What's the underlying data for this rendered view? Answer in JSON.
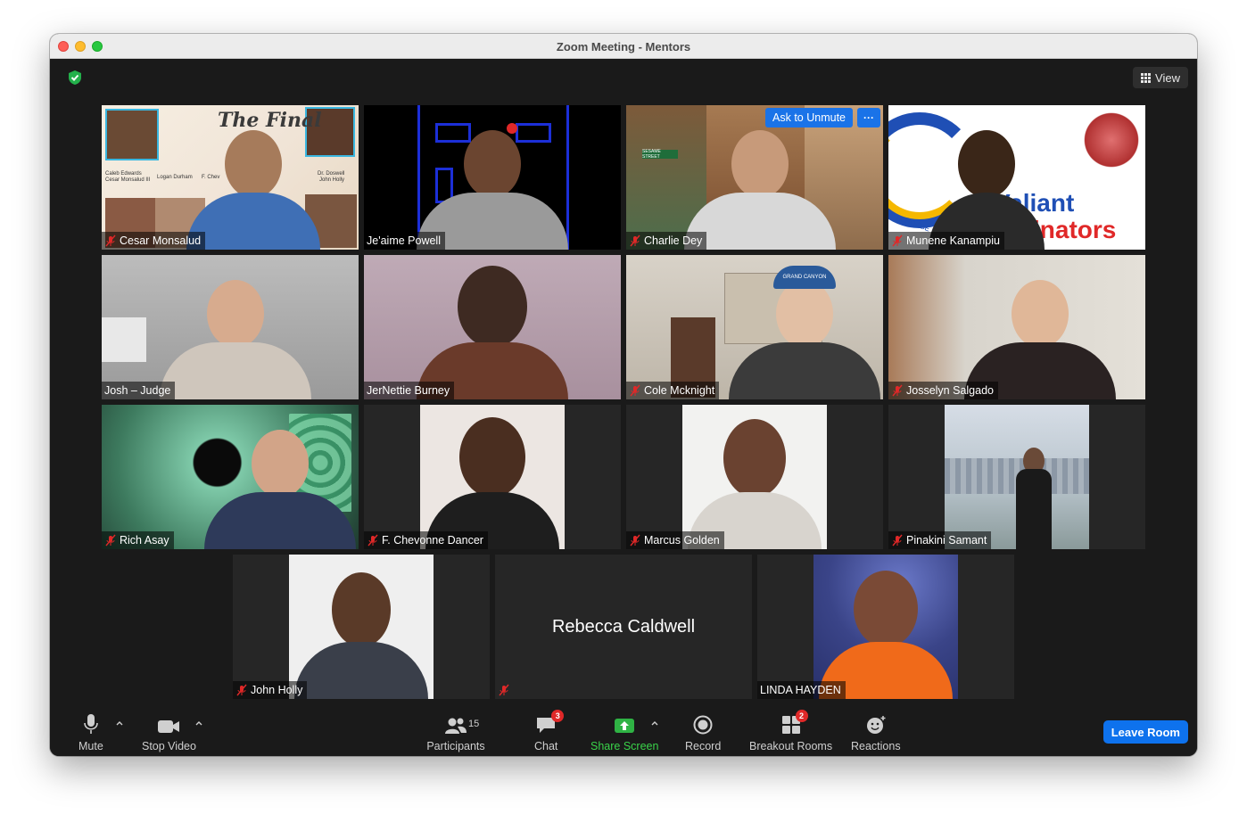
{
  "window": {
    "title": "Zoom Meeting - Mentors"
  },
  "header": {
    "view_label": "View"
  },
  "participants": [
    {
      "name": "Cesar Monsalud",
      "muted": true
    },
    {
      "name": "Je'aime Powell",
      "muted": false
    },
    {
      "name": "Charlie Dey",
      "muted": true
    },
    {
      "name": "Munene Kanampiu",
      "muted": true
    },
    {
      "name": "Josh – Judge",
      "muted": false
    },
    {
      "name": "JerNettie Burney",
      "muted": false
    },
    {
      "name": "Cole Mcknight",
      "muted": true
    },
    {
      "name": "Josselyn Salgado",
      "muted": true
    },
    {
      "name": "Rich Asay",
      "muted": true
    },
    {
      "name": "F. Chevonne Dancer",
      "muted": true
    },
    {
      "name": "Marcus Golden",
      "muted": true
    },
    {
      "name": "Pinakini Samant",
      "muted": true
    },
    {
      "name": "John Holly",
      "muted": true
    },
    {
      "name": "Rebecca Caldwell",
      "muted": true
    },
    {
      "name": "LINDA HAYDEN",
      "muted": false
    }
  ],
  "tile_overlay": {
    "ask_to_unmute": "Ask to Unmute",
    "more": "···"
  },
  "virtual_backgrounds": {
    "cesar": {
      "title": "The Final",
      "labels": [
        "Caleb Edwards",
        "Cesar Monsalud III",
        "Logan Durham",
        "F. Chev",
        "Dr. Doswell",
        "John Holly"
      ]
    },
    "munene": {
      "line1": "Valiant",
      "line2": "inators",
      "slogan": "I CHOOSE"
    },
    "charlie": {
      "sign": "SESAME STREET"
    },
    "cole": {
      "cap": "GRAND CANYON"
    }
  },
  "toolbar": {
    "mute": "Mute",
    "stop_video": "Stop Video",
    "participants": "Participants",
    "participants_count": "15",
    "chat": "Chat",
    "chat_badge": "3",
    "share_screen": "Share Screen",
    "record": "Record",
    "breakout_rooms": "Breakout Rooms",
    "breakout_badge": "2",
    "reactions": "Reactions",
    "leave": "Leave Room"
  },
  "colors": {
    "accent_blue": "#0e72ed",
    "share_green": "#3ad34a",
    "badge_red": "#e02828",
    "active_speaker": "#d8e07a"
  }
}
